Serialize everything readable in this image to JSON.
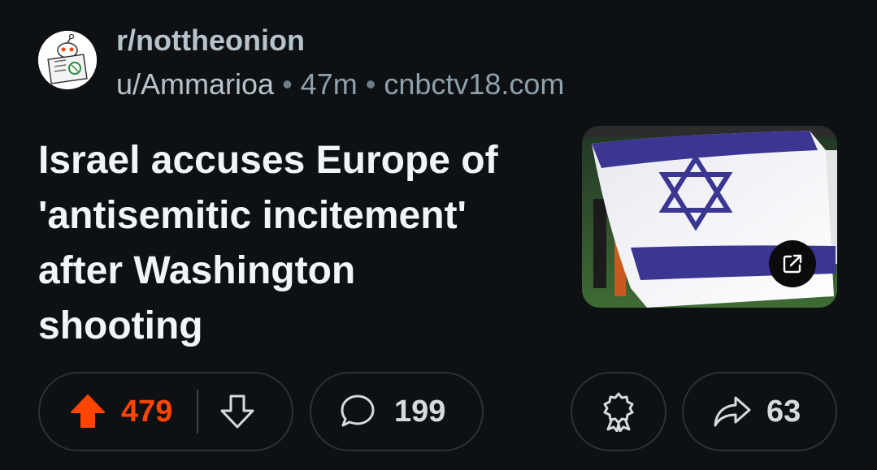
{
  "post": {
    "subreddit": "r/nottheonion",
    "author": "u/Ammarioa",
    "age": "47m",
    "domain": "cnbctv18.com",
    "title": "Israel accuses Europe of 'antisemitic incitement' after Washington shooting",
    "thumbnail_icon": "external-link-icon"
  },
  "actions": {
    "upvotes": "479",
    "comments": "199",
    "shares": "63"
  },
  "colors": {
    "background": "#0e1113",
    "upvote_active": "#ff4500",
    "muted_text": "#b7c3cb",
    "pill_border": "#2b3236"
  }
}
